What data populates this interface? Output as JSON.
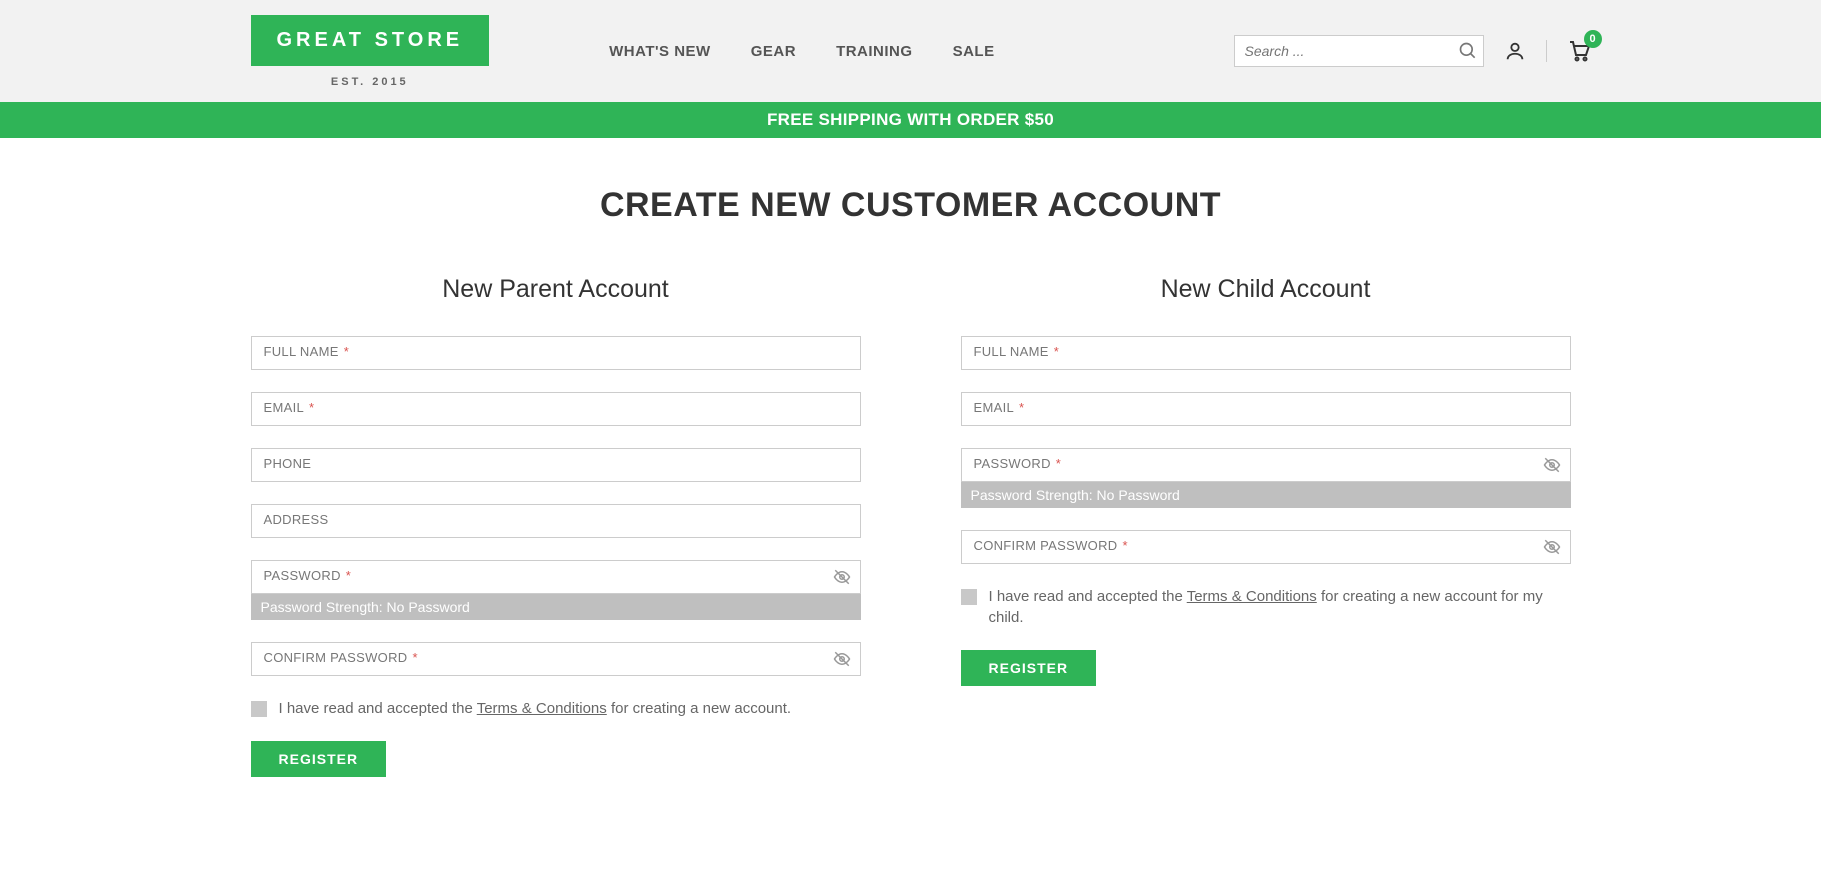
{
  "header": {
    "logo_main": "GREAT STORE",
    "logo_sub": "EST. 2015",
    "nav": [
      "WHAT'S NEW",
      "GEAR",
      "TRAINING",
      "SALE"
    ],
    "search_placeholder": "Search ...",
    "cart_count": "0"
  },
  "banner": "FREE SHIPPING WITH ORDER $50",
  "page_title": "CREATE NEW CUSTOMER ACCOUNT",
  "parent": {
    "title": "New Parent Account",
    "full_name": "FULL NAME",
    "email": "EMAIL",
    "phone": "PHONE",
    "address": "ADDRESS",
    "password": "PASSWORD",
    "confirm_password": "CONFIRM PASSWORD",
    "pw_strength": "Password Strength: No Password",
    "terms_pre": "I have read and accepted the ",
    "terms_link": "Terms & Conditions",
    "terms_post": " for creating a new account.",
    "register": "REGISTER"
  },
  "child": {
    "title": "New Child Account",
    "full_name": "FULL NAME",
    "email": "EMAIL",
    "password": "PASSWORD",
    "confirm_password": "CONFIRM PASSWORD",
    "pw_strength": "Password Strength: No Password",
    "terms_pre": "I have read and accepted the ",
    "terms_link": "Terms & Conditions",
    "terms_post": " for creating a new account for my child.",
    "register": "REGISTER"
  }
}
